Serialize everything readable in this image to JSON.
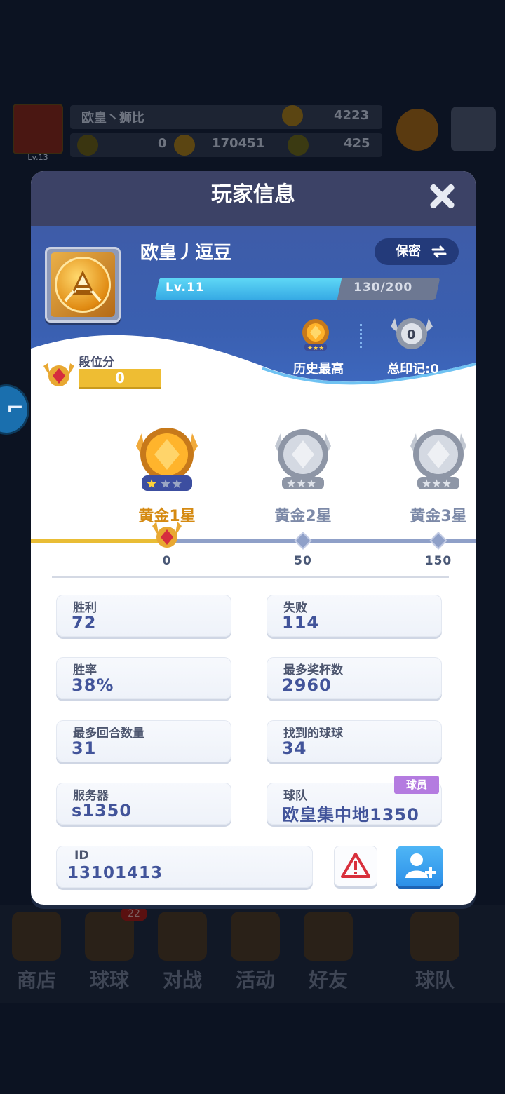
{
  "background": {
    "player_name": "欧皇丶狮比",
    "level": "Lv.13",
    "trophies": "4223",
    "stat1": "0",
    "coins": "170451",
    "gems": "425",
    "nav": [
      "商店",
      "球球",
      "对战",
      "活动",
      "好友",
      "球队"
    ],
    "nav_badge": "22"
  },
  "modal": {
    "title": "玩家信息",
    "player_name": "欧皇丿逗豆",
    "privacy_label": "保密",
    "level_label": "Lv.11",
    "exp_text": "130/200",
    "exp_progress": 0.65,
    "history_best_label": "历史最高",
    "total_seals_label": "总印记:0",
    "total_seals_count": "0",
    "rank_points_label": "段位分",
    "rank_points_value": "0",
    "tiers": [
      {
        "name": "黄金1星",
        "threshold": "0",
        "reached": true
      },
      {
        "name": "黄金2星",
        "threshold": "50",
        "reached": false
      },
      {
        "name": "黄金3星",
        "threshold": "150",
        "reached": false
      }
    ],
    "stats": [
      {
        "label": "胜利",
        "value": "72"
      },
      {
        "label": "失败",
        "value": "114"
      },
      {
        "label": "胜率",
        "value": "38%"
      },
      {
        "label": "最多奖杯数",
        "value": "2960"
      },
      {
        "label": "最多回合数量",
        "value": "31"
      },
      {
        "label": "找到的球球",
        "value": "34"
      },
      {
        "label": "服务器",
        "value": "s1350"
      },
      {
        "label": "球队",
        "value": "欧皇集中地1350",
        "badge": "球员"
      }
    ],
    "id_label": "ID",
    "id_value": "13101413"
  },
  "colors": {
    "modal_header": "#3c4266",
    "profile_blue": "#3a5fb0",
    "gold": "#e9bd35",
    "stat_value": "#42549a",
    "tier_gold": "#d58a12",
    "tier_silver": "#7d8aa8"
  }
}
